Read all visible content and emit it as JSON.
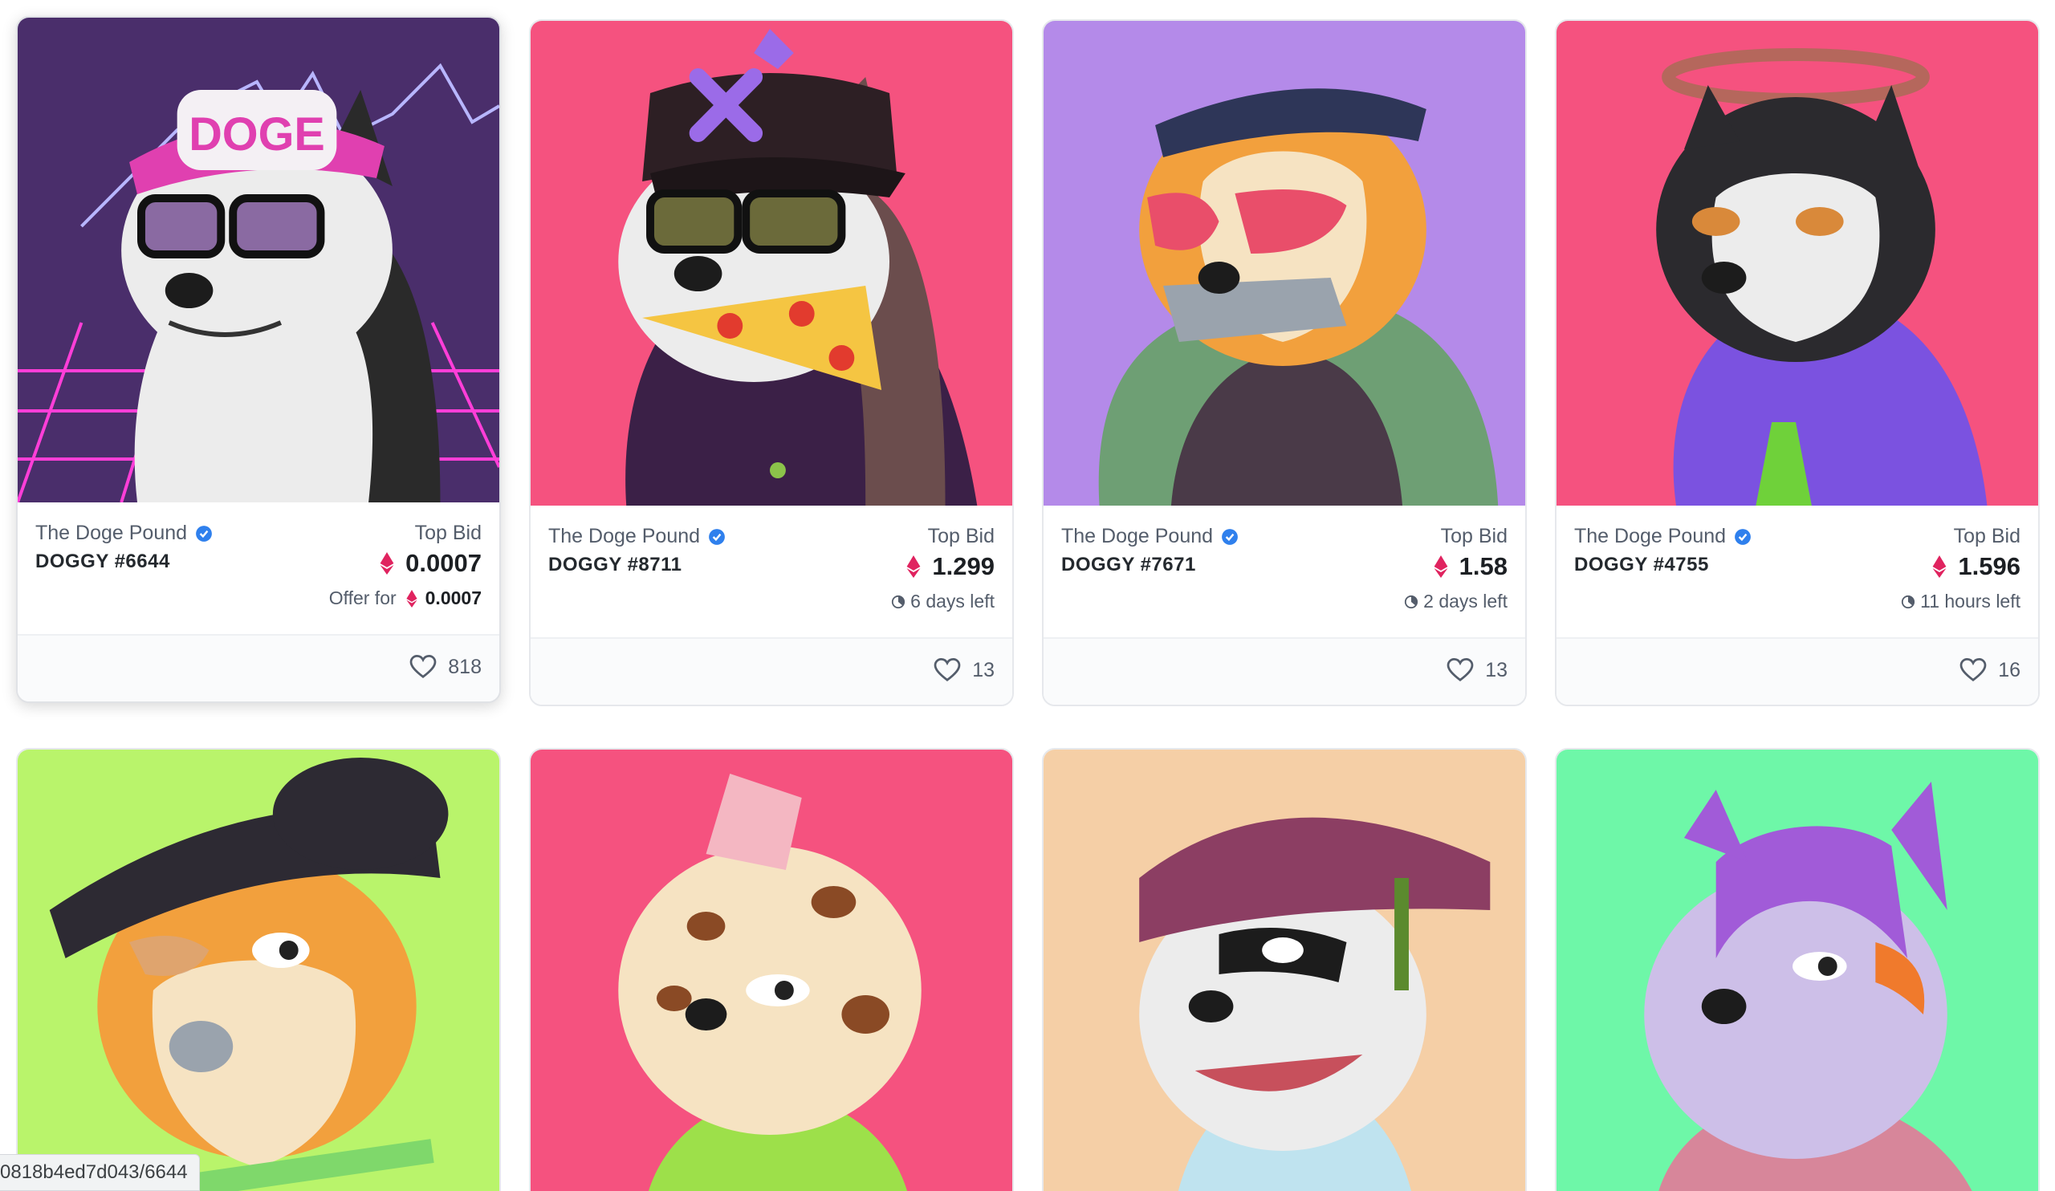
{
  "top_cards": [
    {
      "collection": "The Doge Pound",
      "name": "DOGGY #6644",
      "bid_label": "Top Bid",
      "bid_value": "0.0007",
      "offer_prefix": "Offer for",
      "offer_value": "0.0007",
      "likes": "818",
      "bg_color": "#4a2e6b"
    },
    {
      "collection": "The Doge Pound",
      "name": "DOGGY #8711",
      "bid_label": "Top Bid",
      "bid_value": "1.299",
      "time_left": "6 days left",
      "likes": "13",
      "bg_color": "#f5527f"
    },
    {
      "collection": "The Doge Pound",
      "name": "DOGGY #7671",
      "bid_label": "Top Bid",
      "bid_value": "1.58",
      "time_left": "2 days left",
      "likes": "13",
      "bg_color": "#b48ae9"
    },
    {
      "collection": "The Doge Pound",
      "name": "DOGGY #4755",
      "bid_label": "Top Bid",
      "bid_value": "1.596",
      "time_left": "11 hours left",
      "likes": "16",
      "bg_color": "#f5527f"
    }
  ],
  "bottom_cards": [
    {
      "bg_color": "#b9f46b"
    },
    {
      "bg_color": "#f5527f"
    },
    {
      "bg_color": "#f5cfa6"
    },
    {
      "bg_color": "#6ef7a8"
    }
  ],
  "status_url": "0818b4ed7d043/6644",
  "colors": {
    "eth_icon": "#e0235f",
    "verified": "#2f80ed"
  }
}
